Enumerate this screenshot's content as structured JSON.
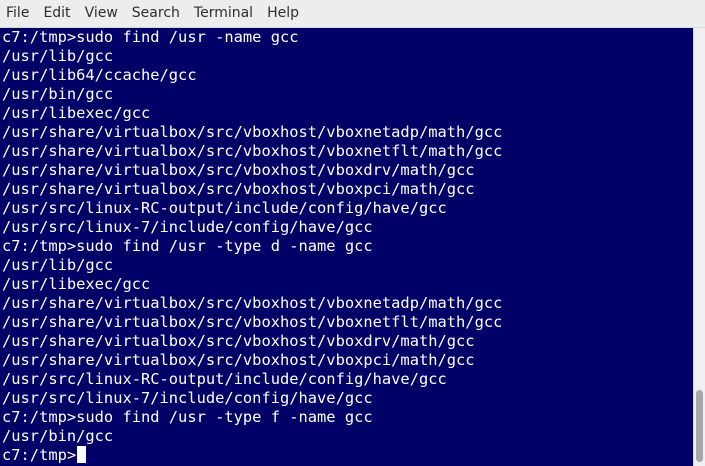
{
  "menu": [
    "File",
    "Edit",
    "View",
    "Search",
    "Terminal",
    "Help"
  ],
  "terminal": {
    "lines": [
      "c7:/tmp>sudo find /usr -name gcc",
      "/usr/lib/gcc",
      "/usr/lib64/ccache/gcc",
      "/usr/bin/gcc",
      "/usr/libexec/gcc",
      "/usr/share/virtualbox/src/vboxhost/vboxnetadp/math/gcc",
      "/usr/share/virtualbox/src/vboxhost/vboxnetflt/math/gcc",
      "/usr/share/virtualbox/src/vboxhost/vboxdrv/math/gcc",
      "/usr/share/virtualbox/src/vboxhost/vboxpci/math/gcc",
      "/usr/src/linux-RC-output/include/config/have/gcc",
      "/usr/src/linux-7/include/config/have/gcc",
      "c7:/tmp>sudo find /usr -type d -name gcc",
      "/usr/lib/gcc",
      "/usr/libexec/gcc",
      "/usr/share/virtualbox/src/vboxhost/vboxnetadp/math/gcc",
      "/usr/share/virtualbox/src/vboxhost/vboxnetflt/math/gcc",
      "/usr/share/virtualbox/src/vboxhost/vboxdrv/math/gcc",
      "/usr/share/virtualbox/src/vboxhost/vboxpci/math/gcc",
      "/usr/src/linux-RC-output/include/config/have/gcc",
      "/usr/src/linux-7/include/config/have/gcc",
      "c7:/tmp>sudo find /usr -type f -name gcc",
      "/usr/bin/gcc"
    ],
    "prompt": "c7:/tmp>",
    "colors": {
      "background": "#000066",
      "foreground": "#ffffff"
    }
  }
}
